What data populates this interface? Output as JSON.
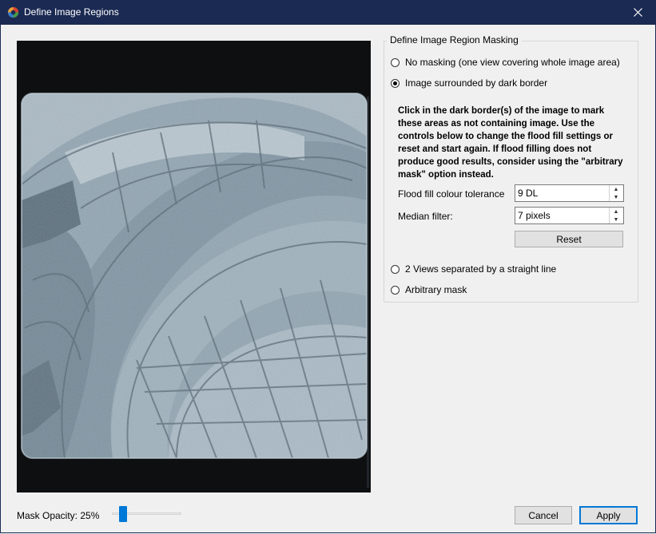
{
  "window": {
    "title": "Define Image Regions"
  },
  "masking": {
    "group_title": "Define Image Region Masking",
    "options": [
      {
        "label": "No masking (one view covering whole image area)",
        "checked": false
      },
      {
        "label": "Image surrounded by dark border",
        "checked": true
      },
      {
        "label": "2 Views separated by a straight line",
        "checked": false
      },
      {
        "label": "Arbitrary mask",
        "checked": false
      }
    ],
    "instructions": "Click in the dark border(s) of the image to mark these areas as not containing image. Use the controls below to change the flood fill settings or reset and start again. If flood filling does not produce good results, consider using the \"arbitrary mask\" option instead.",
    "tolerance": {
      "label": "Flood fill colour tolerance",
      "value": "9 DL"
    },
    "median": {
      "label": "Median filter:",
      "value": "7 pixels"
    },
    "reset_label": "Reset"
  },
  "footer": {
    "opacity_label": "Mask Opacity: 25%",
    "opacity_value": 0.25,
    "cancel_label": "Cancel",
    "apply_label": "Apply"
  },
  "colors": {
    "title_bar": "#1b2a53",
    "accent": "#0078d7",
    "image_tint": "#8fa6b5"
  }
}
